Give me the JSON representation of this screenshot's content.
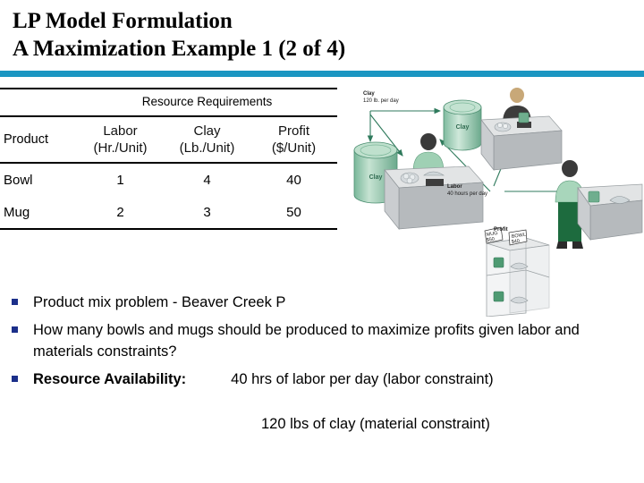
{
  "slide": {
    "title_line1": "LP Model Formulation",
    "title_line2": "A Maximization Example 1 (2 of 4)",
    "accent_color": "#1b96c2",
    "bullet_color": "#1b2f8a"
  },
  "table": {
    "group_header": "Resource Requirements",
    "columns": [
      {
        "label": "Product",
        "unit": ""
      },
      {
        "label": "Labor",
        "unit": "(Hr./Unit)"
      },
      {
        "label": "Clay",
        "unit": "(Lb./Unit)"
      },
      {
        "label": "Profit",
        "unit": "($/Unit)"
      }
    ],
    "rows": [
      {
        "product": "Bowl",
        "labor": "1",
        "clay": "4",
        "profit": "40"
      },
      {
        "product": "Mug",
        "labor": "2",
        "clay": "3",
        "profit": "50"
      }
    ]
  },
  "bullets": [
    {
      "text": "Product mix problem - Beaver Creek P"
    },
    {
      "text": "How many bowls and mugs should be produced to maximize profits given labor and materials constraints?"
    }
  ],
  "resource_bullet": {
    "lead": "Resource Availability:",
    "value": "40 hrs of labor per day (labor constraint)",
    "second_value": "120 lbs of clay (material constraint)"
  },
  "illustration": {
    "clay_label_title": "Clay",
    "clay_label_sub": "120 lb. per day",
    "labor_label_title": "Labor",
    "labor_label_sub": "40 hours per day",
    "profit_label": "Profit",
    "barrel_label": "Clay",
    "tag_mug_line1": "MUG",
    "tag_mug_line2": "$50",
    "tag_bowl_line1": "BOWL",
    "tag_bowl_line2": "$40"
  }
}
